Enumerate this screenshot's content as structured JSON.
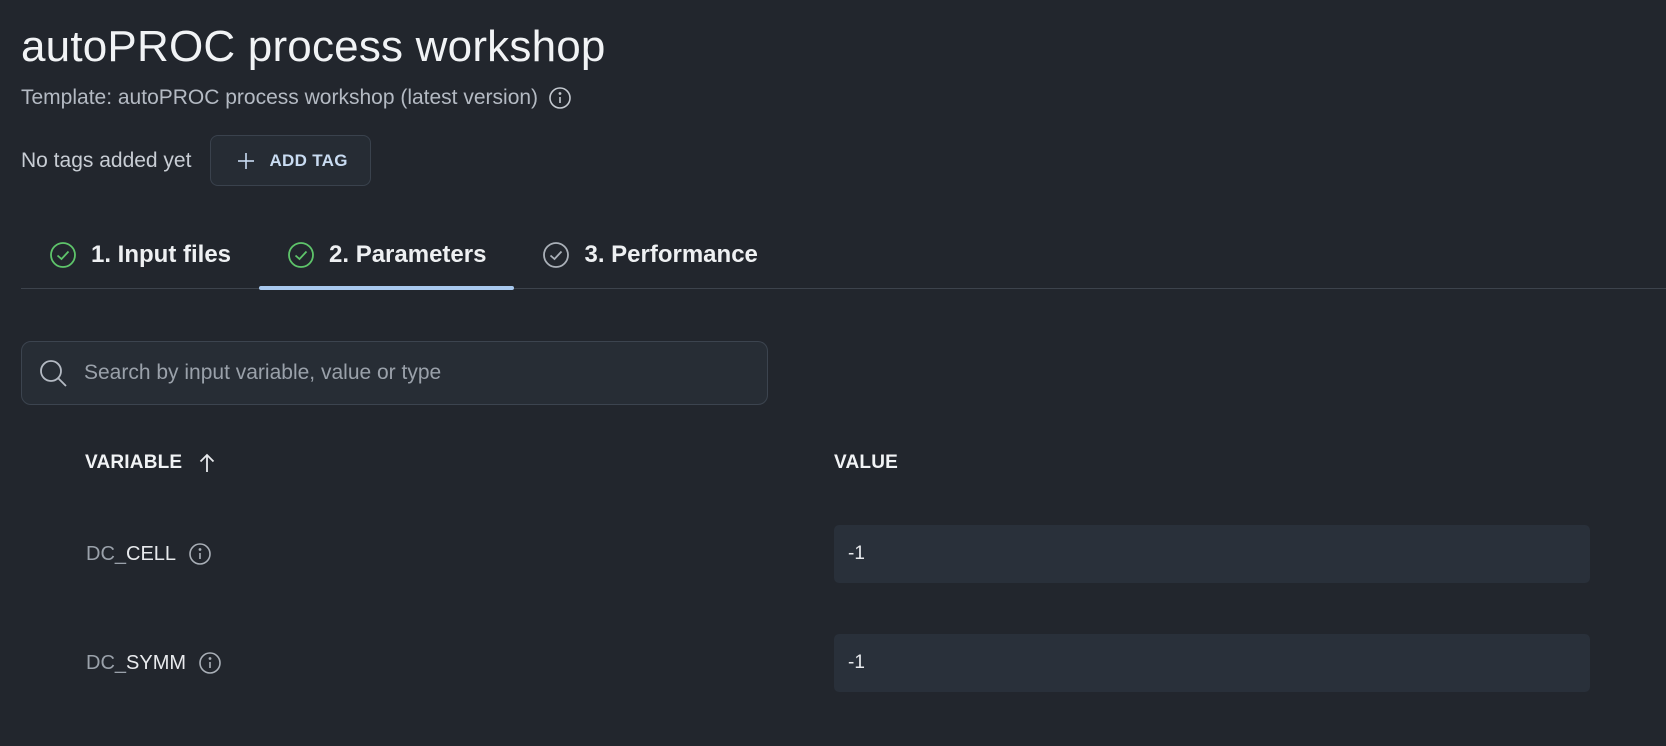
{
  "header": {
    "title": "autoPROC process workshop",
    "template_label": "Template: autoPROC process workshop (latest version)"
  },
  "tags": {
    "empty_text": "No tags added yet",
    "add_label": "ADD TAG"
  },
  "tabs": [
    {
      "label": "1. Input files",
      "status": "complete"
    },
    {
      "label": "2. Parameters",
      "status": "complete",
      "active": true
    },
    {
      "label": "3. Performance",
      "status": "pending"
    }
  ],
  "search": {
    "placeholder": "Search by input variable, value or type",
    "value": ""
  },
  "table": {
    "columns": {
      "variable": "VARIABLE",
      "value": "VALUE"
    },
    "sort": "ascending",
    "rows": [
      {
        "prefix": "DC_",
        "name": "CELL",
        "value": "-1"
      },
      {
        "prefix": "DC_",
        "name": "SYMM",
        "value": "-1"
      }
    ]
  },
  "icons": {
    "info": "info-circle-icon",
    "add": "plus-icon",
    "tab_complete": "check-circle-icon",
    "search": "search-icon",
    "sort": "arrow-up-icon"
  },
  "colors": {
    "background": "#22262d",
    "accent": "#a8c8ee",
    "success": "#5ec46a",
    "pending": "#aab0b8"
  }
}
